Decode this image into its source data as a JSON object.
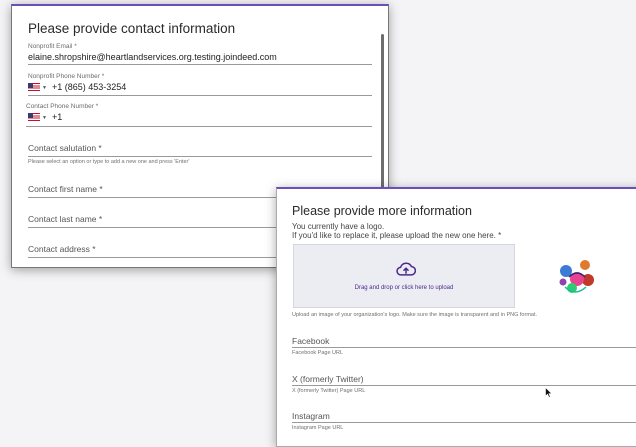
{
  "contact_form": {
    "title": "Please provide contact information",
    "nonprofit_email": {
      "label": "Nonprofit Email *",
      "value": "elaine.shropshire@heartlandservices.org.testing.joindeed.com"
    },
    "nonprofit_phone": {
      "label": "Nonprofit Phone Number *",
      "value": "+1 (865) 453-3254"
    },
    "contact_phone": {
      "label": "Contact Phone Number *",
      "value": "+1"
    },
    "contact_salutation": {
      "placeholder": "Contact salutation *",
      "help": "Please select an option or type to add a new one and press 'Enter'"
    },
    "contact_first_name": {
      "placeholder": "Contact first name *"
    },
    "contact_last_name": {
      "placeholder": "Contact last name *"
    },
    "contact_address": {
      "placeholder": "Contact address *"
    }
  },
  "more_info_form": {
    "title": "Please provide more information",
    "logo_line1": "You currently have a logo.",
    "logo_line2": "If you'd like to replace it, please upload the new one here. *",
    "dropzone_text": "Drag and drop or click here to upload",
    "upload_help": "Upload an image of your organization's logo. Make sure the image is transparent and in PNG format.",
    "facebook": {
      "placeholder": "Facebook",
      "help": "Facebook Page URL"
    },
    "twitter": {
      "placeholder": "X (formerly Twitter)",
      "help": "X (formerly Twitter) Page URL"
    },
    "instagram": {
      "placeholder": "Instagram",
      "help": "Instagram Page URL"
    }
  },
  "icons": {
    "flag": "us-flag-icon",
    "dropdown": "chevron-down-icon",
    "upload": "cloud-upload-icon",
    "logo": "organization-logo",
    "cursor": "mouse-pointer-icon"
  },
  "colors": {
    "accent": "#6a4fb8",
    "upload_purple": "#4b2a8a",
    "dropzone_bg": "#ececf3"
  }
}
